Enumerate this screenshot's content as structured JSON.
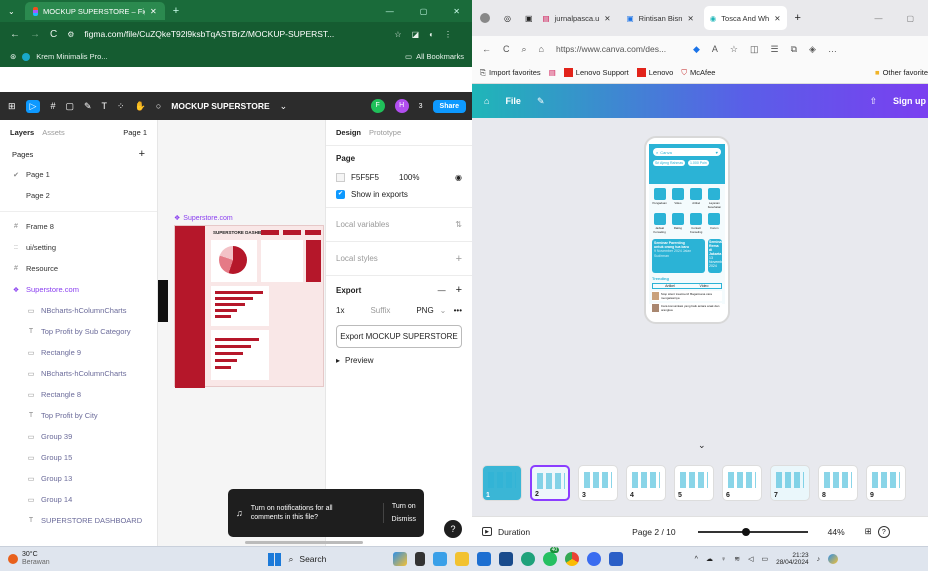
{
  "left": {
    "tab_title": "MOCKUP SUPERSTORE – Figma",
    "url": "figma.com/file/CuZQkeT92l9ksbTqASTBrZ/MOCKUP-SUPERST...",
    "bookmark": "Krem Minimalis Pro...",
    "all_bookmarks": "All Bookmarks",
    "file_name": "MOCKUP SUPERSTORE",
    "avatar_f": "F",
    "avatar_h": "H",
    "avatar_count": "3",
    "share": "Share",
    "tabs": {
      "layers": "Layers",
      "assets": "Assets",
      "page": "Page 1"
    },
    "pages_label": "Pages",
    "pages": [
      "Page 1",
      "Page 2"
    ],
    "layers": [
      {
        "name": "Frame 8",
        "sub": false,
        "icon": "#"
      },
      {
        "name": "ui/setting",
        "sub": false,
        "icon": "::"
      },
      {
        "name": "Resource",
        "sub": false,
        "icon": "#"
      },
      {
        "name": "Superstore.com",
        "sub": false,
        "icon": "❖",
        "purple": true
      },
      {
        "name": "NBcharts-hColumnCharts",
        "sub": true,
        "icon": "▭"
      },
      {
        "name": "Top Profit by Sub Category",
        "sub": true,
        "icon": "T"
      },
      {
        "name": "Rectangle 9",
        "sub": true,
        "icon": "▭"
      },
      {
        "name": "NBcharts-hColumnCharts",
        "sub": true,
        "icon": "▭"
      },
      {
        "name": "Rectangle 8",
        "sub": true,
        "icon": "▭"
      },
      {
        "name": "Top Profit by City",
        "sub": true,
        "icon": "T"
      },
      {
        "name": "Group 39",
        "sub": true,
        "icon": "▭"
      },
      {
        "name": "Group 15",
        "sub": true,
        "icon": "▭"
      },
      {
        "name": "Group 13",
        "sub": true,
        "icon": "▭"
      },
      {
        "name": "Group 14",
        "sub": true,
        "icon": "▭"
      },
      {
        "name": "SUPERSTORE DASHBOARD",
        "sub": true,
        "icon": "T"
      }
    ],
    "frame_label": "Superstore.com",
    "frame_title": "SUPERSTORE DASHBOARD",
    "design": {
      "tab_design": "Design",
      "tab_prototype": "Prototype",
      "page": "Page",
      "color": "F5F5F5",
      "opacity": "100%",
      "show_in_exports": "Show in exports",
      "local_variables": "Local variables",
      "local_styles": "Local styles",
      "export": "Export",
      "scale": "1x",
      "suffix": "Suffix",
      "format": "PNG",
      "export_button": "Export MOCKUP SUPERSTORE",
      "preview": "Preview"
    },
    "toast": {
      "text": "Turn on notifications for all comments in this file?",
      "turn_on": "Turn on",
      "dismiss": "Dismiss"
    },
    "help": "?"
  },
  "right": {
    "tabs": [
      "jurnalpasca.u",
      "Rintisan Bisn",
      "Tosca And Wh"
    ],
    "url": "https://www.canva.com/des...",
    "bookmarks": [
      "Import favorites",
      "Lenovo Support",
      "Lenovo",
      "McAfee"
    ],
    "other_favorites": "Other favorite",
    "file_menu": "File",
    "sign_up": "Sign up",
    "phone": {
      "search_label": "Canva",
      "chip1": "Sri Ajeng Rahmas",
      "chip2": "1.000 Poin",
      "grid": [
        "Pengaduan",
        "Video",
        "Artikel",
        "Layanan Kesehatan",
        "Jadwal Konseling",
        "Rating",
        "Contact Konseling",
        "Forum"
      ],
      "banner1_title": "Seminar Parenting untuk orang tua baru",
      "banner1_date": "9 November 2024 Jalan Sudirman",
      "banner2_title": "Seminar Rema di Jakarta",
      "banner2_date": "13 November 2024",
      "trending": "Trending",
      "tab_artikel": "Artikel",
      "tab_video": "Video",
      "article1": "Stop silent treatment! Bagaimana cara mengatasinya",
      "article2": "Cara komunikasi yang baik antara anak dan orangtua"
    },
    "thumb_numbers": [
      "1",
      "2",
      "3",
      "4",
      "5",
      "6",
      "7",
      "8",
      "9"
    ],
    "duration": "Duration",
    "page_indicator": "Page 2 / 10",
    "zoom": "44%",
    "help": "?"
  },
  "taskbar": {
    "weather_temp": "30°C",
    "weather_text": "Berawan",
    "search": "Search",
    "badge": "40",
    "time": "21:23",
    "date": "28/04/2024"
  },
  "chart_colors": {
    "figma_accent": "#0d99ff",
    "dashboard_red": "#b5172a",
    "canva_teal": "#2bb3d6"
  }
}
